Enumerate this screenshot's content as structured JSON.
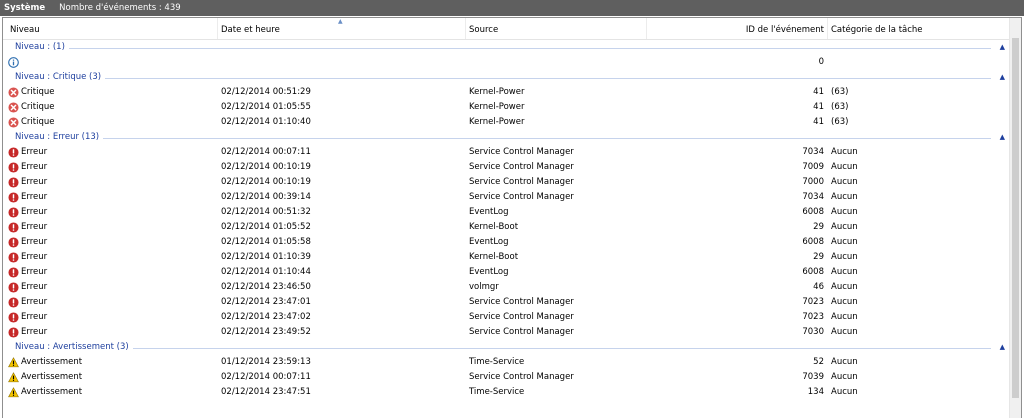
{
  "topbar": {
    "title": "Système",
    "count": "Nombre d'événements : 439"
  },
  "columns": {
    "level": "Niveau",
    "date": "Date et heure",
    "source": "Source",
    "event_id": "ID de l'événement",
    "category": "Catégorie de la tâche"
  },
  "icons": {
    "info": "info-icon",
    "critical": "critical-error-icon",
    "error": "error-icon",
    "warning": "warning-icon"
  },
  "colors": {
    "topbar": "#5f5f5f",
    "group_label": "#1e3f9e",
    "critical": "#d9534f",
    "error": "#c62828",
    "warning": "#f2c300",
    "info": "#2f6fb0"
  },
  "groups": [
    {
      "label": "Niveau : (1)",
      "rows": [
        {
          "level": "",
          "icon": "info",
          "date": "",
          "source": "",
          "id": "0",
          "category": ""
        }
      ]
    },
    {
      "label": "Niveau : Critique (3)",
      "rows": [
        {
          "level": "Critique",
          "icon": "critical",
          "date": "02/12/2014 00:51:29",
          "source": "Kernel-Power",
          "id": "41",
          "category": "(63)"
        },
        {
          "level": "Critique",
          "icon": "critical",
          "date": "02/12/2014 01:05:55",
          "source": "Kernel-Power",
          "id": "41",
          "category": "(63)"
        },
        {
          "level": "Critique",
          "icon": "critical",
          "date": "02/12/2014 01:10:40",
          "source": "Kernel-Power",
          "id": "41",
          "category": "(63)"
        }
      ]
    },
    {
      "label": "Niveau : Erreur (13)",
      "rows": [
        {
          "level": "Erreur",
          "icon": "error",
          "date": "02/12/2014 00:07:11",
          "source": "Service Control Manager",
          "id": "7034",
          "category": "Aucun"
        },
        {
          "level": "Erreur",
          "icon": "error",
          "date": "02/12/2014 00:10:19",
          "source": "Service Control Manager",
          "id": "7009",
          "category": "Aucun"
        },
        {
          "level": "Erreur",
          "icon": "error",
          "date": "02/12/2014 00:10:19",
          "source": "Service Control Manager",
          "id": "7000",
          "category": "Aucun"
        },
        {
          "level": "Erreur",
          "icon": "error",
          "date": "02/12/2014 00:39:14",
          "source": "Service Control Manager",
          "id": "7034",
          "category": "Aucun"
        },
        {
          "level": "Erreur",
          "icon": "error",
          "date": "02/12/2014 00:51:32",
          "source": "EventLog",
          "id": "6008",
          "category": "Aucun"
        },
        {
          "level": "Erreur",
          "icon": "error",
          "date": "02/12/2014 01:05:52",
          "source": "Kernel-Boot",
          "id": "29",
          "category": "Aucun"
        },
        {
          "level": "Erreur",
          "icon": "error",
          "date": "02/12/2014 01:05:58",
          "source": "EventLog",
          "id": "6008",
          "category": "Aucun"
        },
        {
          "level": "Erreur",
          "icon": "error",
          "date": "02/12/2014 01:10:39",
          "source": "Kernel-Boot",
          "id": "29",
          "category": "Aucun"
        },
        {
          "level": "Erreur",
          "icon": "error",
          "date": "02/12/2014 01:10:44",
          "source": "EventLog",
          "id": "6008",
          "category": "Aucun"
        },
        {
          "level": "Erreur",
          "icon": "error",
          "date": "02/12/2014 23:46:50",
          "source": "volmgr",
          "id": "46",
          "category": "Aucun"
        },
        {
          "level": "Erreur",
          "icon": "error",
          "date": "02/12/2014 23:47:01",
          "source": "Service Control Manager",
          "id": "7023",
          "category": "Aucun"
        },
        {
          "level": "Erreur",
          "icon": "error",
          "date": "02/12/2014 23:47:02",
          "source": "Service Control Manager",
          "id": "7023",
          "category": "Aucun"
        },
        {
          "level": "Erreur",
          "icon": "error",
          "date": "02/12/2014 23:49:52",
          "source": "Service Control Manager",
          "id": "7030",
          "category": "Aucun"
        }
      ]
    },
    {
      "label": "Niveau : Avertissement (3)",
      "rows": [
        {
          "level": "Avertissement",
          "icon": "warning",
          "date": "01/12/2014 23:59:13",
          "source": "Time-Service",
          "id": "52",
          "category": "Aucun"
        },
        {
          "level": "Avertissement",
          "icon": "warning",
          "date": "02/12/2014 00:07:11",
          "source": "Service Control Manager",
          "id": "7039",
          "category": "Aucun"
        },
        {
          "level": "Avertissement",
          "icon": "warning",
          "date": "02/12/2014 23:47:51",
          "source": "Time-Service",
          "id": "134",
          "category": "Aucun"
        }
      ]
    }
  ]
}
